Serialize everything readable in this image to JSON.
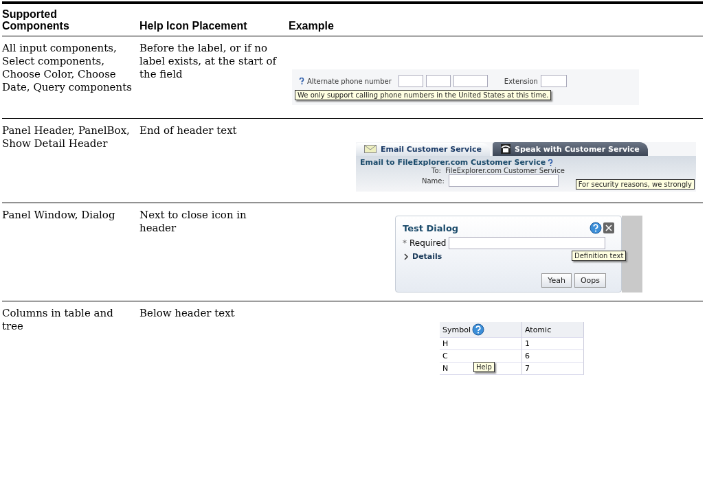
{
  "columns": [
    "Supported Components",
    "Help Icon Placement",
    "Example"
  ],
  "rows": [
    {
      "components": "All input components, Select components, Choose Color, Choose Date, Query components",
      "placement": "Before the label, or if no label exists, at the start of the field",
      "example": {
        "kind": "phone",
        "label": "Alternate phone number",
        "extension": "Extension",
        "tooltip": "We only support calling phone numbers in the United States at this time."
      }
    },
    {
      "components": "Panel Header, PanelBox, Show Detail Header",
      "placement": "End of header text",
      "example": {
        "kind": "panel",
        "tabs": [
          {
            "label": "Email Customer Service",
            "selected": true
          },
          {
            "label": "Speak with Customer Service",
            "selected": false
          }
        ],
        "header": "Email to FileExplorer.com Customer Service",
        "to_label": "To:",
        "to_value": "FileExplorer.com Customer Service",
        "name_label": "Name:",
        "tooltip": "For security reasons, we strongly"
      }
    },
    {
      "components": "Panel Window, Dialog",
      "placement": "Next to close icon in header",
      "example": {
        "kind": "dialog",
        "title": "Test Dialog",
        "required_mark": "*",
        "field_label": "Required",
        "tooltip": "Definition text",
        "disclosure": "Details",
        "buttons": [
          "Yeah",
          "Oops"
        ]
      }
    },
    {
      "components": "Columns in table and tree",
      "placement": "Below header text",
      "example": {
        "kind": "table",
        "columns": [
          "Symbol",
          "Atomic"
        ],
        "rows": [
          [
            "H",
            "1"
          ],
          [
            "C",
            "6"
          ],
          [
            "N",
            "7"
          ]
        ],
        "tooltip": "Help"
      }
    }
  ]
}
